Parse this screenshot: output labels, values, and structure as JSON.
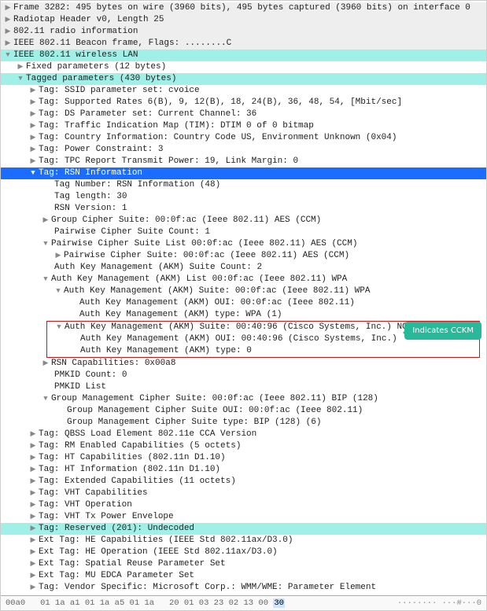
{
  "callout": "Indicates CCKM",
  "header": {
    "frame": "Frame 3282: 495 bytes on wire (3960 bits), 495 bytes captured (3960 bits) on interface 0",
    "radiotap": "Radiotap Header v0, Length 25",
    "radio": "802.11 radio information",
    "beacon": "IEEE 802.11 Beacon frame, Flags: ........C",
    "wlan": "IEEE 802.11 wireless LAN"
  },
  "fixed": "Fixed parameters (12 bytes)",
  "tagged": "Tagged parameters (430 bytes)",
  "tags_top": {
    "ssid": "Tag: SSID parameter set: cvoice",
    "rates": "Tag: Supported Rates 6(B), 9, 12(B), 18, 24(B), 36, 48, 54, [Mbit/sec]",
    "ds": "Tag: DS Parameter set: Current Channel: 36",
    "tim": "Tag: Traffic Indication Map (TIM): DTIM 0 of 0 bitmap",
    "country": "Tag: Country Information: Country Code US, Environment Unknown (0x04)",
    "power": "Tag: Power Constraint: 3",
    "tpc": "Tag: TPC Report Transmit Power: 19, Link Margin: 0"
  },
  "rsn": {
    "title": "Tag: RSN Information",
    "tagnum": "Tag Number: RSN Information (48)",
    "taglen": "Tag length: 30",
    "ver": "RSN Version: 1",
    "gcs": "Group Cipher Suite: 00:0f:ac (Ieee 802.11) AES (CCM)",
    "pcscnt": "Pairwise Cipher Suite Count: 1",
    "pcslist": "Pairwise Cipher Suite List 00:0f:ac (Ieee 802.11) AES (CCM)",
    "pcs": "Pairwise Cipher Suite: 00:0f:ac (Ieee 802.11) AES (CCM)",
    "akmcnt": "Auth Key Management (AKM) Suite Count: 2",
    "akmlist": "Auth Key Management (AKM) List 00:0f:ac (Ieee 802.11) WPA",
    "akm1": {
      "suite": "Auth Key Management (AKM) Suite: 00:0f:ac (Ieee 802.11) WPA",
      "oui": "Auth Key Management (AKM) OUI: 00:0f:ac (Ieee 802.11)",
      "type": "Auth Key Management (AKM) type: WPA (1)"
    },
    "akm2": {
      "suite": "Auth Key Management (AKM) Suite: 00:40:96 (Cisco Systems, Inc.) NONE",
      "oui": "Auth Key Management (AKM) OUI: 00:40:96 (Cisco Systems, Inc.)",
      "type": "Auth Key Management (AKM) type: 0"
    },
    "caps": "RSN Capabilities: 0x00a8",
    "pmkidc": "PMKID Count: 0",
    "pmkidl": "PMKID List",
    "gmcs": {
      "title": "Group Management Cipher Suite: 00:0f:ac (Ieee 802.11) BIP (128)",
      "oui": "Group Management Cipher Suite OUI: 00:0f:ac (Ieee 802.11)",
      "type": "Group Management Cipher Suite type: BIP (128) (6)"
    }
  },
  "tags_bottom": {
    "qbss": "Tag: QBSS Load Element 802.11e CCA Version",
    "rm": "Tag: RM Enabled Capabilities (5 octets)",
    "htcap": "Tag: HT Capabilities (802.11n D1.10)",
    "htinfo": "Tag: HT Information (802.11n D1.10)",
    "ext": "Tag: Extended Capabilities (11 octets)",
    "vhtcap": "Tag: VHT Capabilities",
    "vhtop": "Tag: VHT Operation",
    "vhttx": "Tag: VHT Tx Power Envelope",
    "reserved": "Tag: Reserved (201): Undecoded",
    "he": "Ext Tag: HE Capabilities (IEEE Std 802.11ax/D3.0)",
    "heop": "Ext Tag: HE Operation (IEEE Std 802.11ax/D3.0)",
    "spatial": "Ext Tag: Spatial Reuse Parameter Set",
    "mu": "Ext Tag: MU EDCA Parameter Set",
    "vendor": "Tag: Vendor Specific: Microsoft Corp.: WMM/WME: Parameter Element"
  },
  "hex": {
    "offset": "00a0",
    "bytes_a": "01 1a a1 01 1a a5 01 1a",
    "bytes_b": "20 01 03 23 02 13 00",
    "sel": "30",
    "ascii": "········ ···#···0"
  }
}
